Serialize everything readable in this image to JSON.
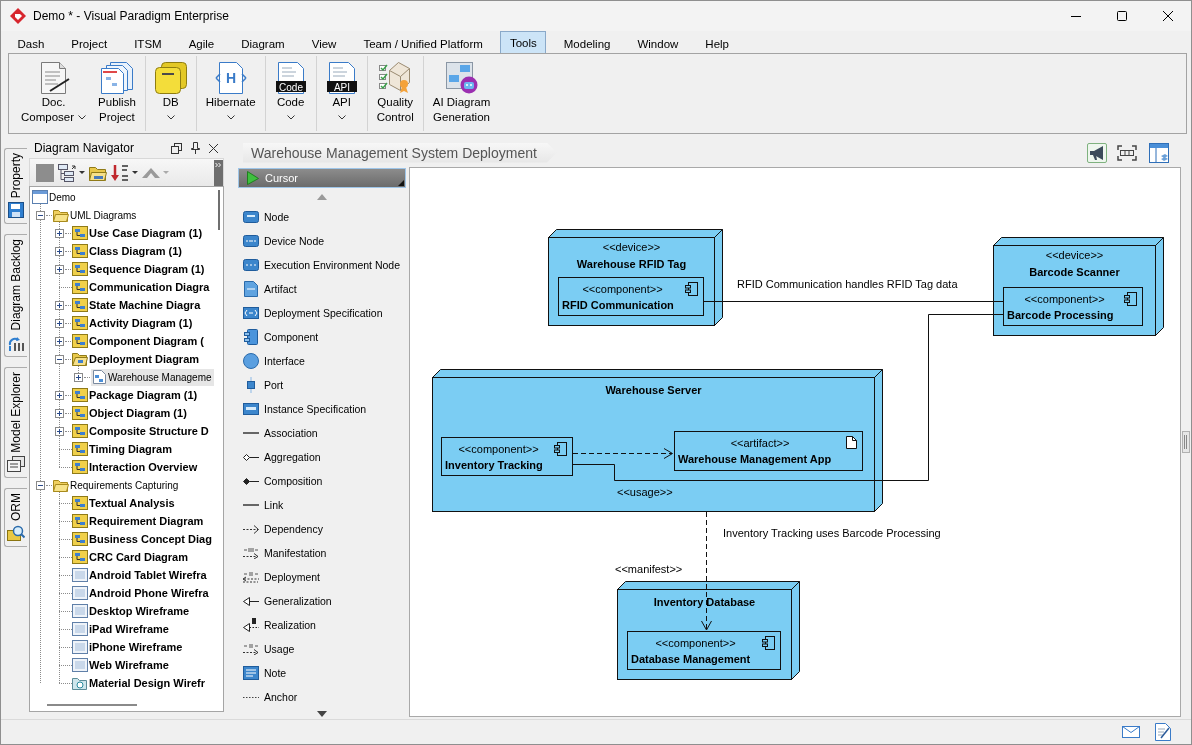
{
  "window": {
    "title": "Demo * - Visual Paradigm Enterprise"
  },
  "menu_tabs": [
    {
      "label": "Dash",
      "selected": false
    },
    {
      "label": "Project",
      "selected": false
    },
    {
      "label": "ITSM",
      "selected": false
    },
    {
      "label": "Agile",
      "selected": false
    },
    {
      "label": "Diagram",
      "selected": false
    },
    {
      "label": "View",
      "selected": false
    },
    {
      "label": "Team / Unified Platform",
      "selected": false
    },
    {
      "label": "Tools",
      "selected": true
    },
    {
      "label": "Modeling",
      "selected": false
    },
    {
      "label": "Window",
      "selected": false
    },
    {
      "label": "Help",
      "selected": false
    }
  ],
  "ribbon": {
    "groups": [
      [
        {
          "kind": "document",
          "lines": [
            "Doc.",
            "Composer"
          ],
          "dropdown": true
        },
        {
          "kind": "publish",
          "lines": [
            "Publish",
            "Project"
          ],
          "dropdown": false
        }
      ],
      [
        {
          "kind": "database",
          "lines": [
            "DB"
          ],
          "dropdown": true
        }
      ],
      [
        {
          "kind": "hibernate",
          "icon_text": "H",
          "lines": [
            "Hibernate"
          ],
          "dropdown": true
        }
      ],
      [
        {
          "kind": "code",
          "icon_text": "Code",
          "lines": [
            "Code"
          ],
          "dropdown": true
        }
      ],
      [
        {
          "kind": "api",
          "icon_text": "API",
          "lines": [
            "API"
          ],
          "dropdown": true
        }
      ],
      [
        {
          "kind": "quality",
          "lines": [
            "Quality",
            "Control"
          ],
          "dropdown": false
        }
      ],
      [
        {
          "kind": "ai-diagram",
          "lines": [
            "AI Diagram",
            "Generation"
          ],
          "dropdown": false
        }
      ]
    ]
  },
  "side_tabs": [
    {
      "label": "Property",
      "kind": "property",
      "selected": false
    },
    {
      "label": "Diagram Backlog",
      "kind": "backlog",
      "selected": false
    },
    {
      "label": "Model Explorer",
      "kind": "explorer",
      "selected": false
    },
    {
      "label": "ORM",
      "kind": "orm",
      "selected": false
    }
  ],
  "navigator": {
    "title": "Diagram Navigator",
    "tree": [
      {
        "label": "Demo",
        "kind": "project",
        "selected": false,
        "children": [
          {
            "label": "UML Diagrams",
            "kind": "folder",
            "expanded": true,
            "selected": false,
            "children": [
              {
                "label": "Use Case Diagram (1)",
                "kind": "uml",
                "expanded": false,
                "selected": false
              },
              {
                "label": "Class Diagram (1)",
                "kind": "uml",
                "expanded": false,
                "selected": false
              },
              {
                "label": "Sequence Diagram (1)",
                "kind": "uml",
                "expanded": false,
                "selected": false
              },
              {
                "label": "Communication Diagra",
                "kind": "uml",
                "selected": false
              },
              {
                "label": "State Machine Diagra",
                "kind": "uml",
                "expanded": false,
                "selected": false
              },
              {
                "label": "Activity Diagram (1)",
                "kind": "uml",
                "expanded": false,
                "selected": false
              },
              {
                "label": "Component Diagram (",
                "kind": "uml",
                "expanded": false,
                "selected": false
              },
              {
                "label": "Deployment Diagram",
                "kind": "uml-open",
                "expanded": true,
                "selected": false,
                "children": [
                  {
                    "label": "Warehouse Manageme",
                    "kind": "diagram",
                    "expanded": false,
                    "selected": true
                  }
                ]
              },
              {
                "label": "Package Diagram (1)",
                "kind": "uml",
                "expanded": false,
                "selected": false
              },
              {
                "label": "Object Diagram (1)",
                "kind": "uml",
                "expanded": false,
                "selected": false
              },
              {
                "label": "Composite Structure D",
                "kind": "uml",
                "expanded": false,
                "selected": false
              },
              {
                "label": "Timing Diagram",
                "kind": "uml",
                "selected": false
              },
              {
                "label": "Interaction Overview",
                "kind": "uml",
                "selected": false
              }
            ]
          },
          {
            "label": "Requirements Capturing",
            "kind": "folder",
            "expanded": true,
            "selected": false,
            "children": [
              {
                "label": "Textual Analysis",
                "kind": "uml",
                "selected": false
              },
              {
                "label": "Requirement Diagram",
                "kind": "uml",
                "selected": false
              },
              {
                "label": "Business Concept Diag",
                "kind": "uml",
                "selected": false
              },
              {
                "label": "CRC Card Diagram",
                "kind": "uml",
                "selected": false
              },
              {
                "label": "Android Tablet Wirefra",
                "kind": "wireframe",
                "selected": false
              },
              {
                "label": "Android Phone Wirefra",
                "kind": "wireframe",
                "selected": false
              },
              {
                "label": "Desktop Wireframe",
                "kind": "wireframe",
                "selected": false
              },
              {
                "label": "iPad Wireframe",
                "kind": "wireframe",
                "selected": false
              },
              {
                "label": "iPhone Wireframe",
                "kind": "wireframe",
                "selected": false
              },
              {
                "label": "Web Wireframe",
                "kind": "wireframe",
                "selected": false
              },
              {
                "label": "Material Design Wirefr",
                "kind": "material",
                "selected": false
              }
            ]
          }
        ]
      }
    ]
  },
  "editor": {
    "breadcrumb": "Warehouse Management System Deployment",
    "palette": {
      "cursor": {
        "label": "Cursor",
        "selected": true
      },
      "tools": [
        {
          "label": "Node",
          "kind": "node",
          "selected": false
        },
        {
          "label": "Device Node",
          "kind": "device-node",
          "selected": false
        },
        {
          "label": "Execution Environment Node",
          "kind": "exec-node",
          "selected": false
        },
        {
          "label": "Artifact",
          "kind": "artifact",
          "selected": false
        },
        {
          "label": "Deployment Specification",
          "kind": "deploy-spec",
          "selected": false
        },
        {
          "label": "Component",
          "kind": "component",
          "selected": false
        },
        {
          "label": "Interface",
          "kind": "interface",
          "selected": false
        },
        {
          "label": "Port",
          "kind": "port",
          "selected": false
        },
        {
          "label": "Instance Specification",
          "kind": "instance-spec",
          "selected": false
        },
        {
          "label": "Association",
          "kind": "association",
          "selected": false
        },
        {
          "label": "Aggregation",
          "kind": "aggregation",
          "selected": false
        },
        {
          "label": "Composition",
          "kind": "composition",
          "selected": false
        },
        {
          "label": "Link",
          "kind": "link",
          "selected": false
        },
        {
          "label": "Dependency",
          "kind": "dependency",
          "selected": false
        },
        {
          "label": "Manifestation",
          "kind": "manifestation",
          "selected": false
        },
        {
          "label": "Deployment",
          "kind": "deployment",
          "selected": false
        },
        {
          "label": "Generalization",
          "kind": "generalization",
          "selected": false
        },
        {
          "label": "Realization",
          "kind": "realization",
          "selected": false
        },
        {
          "label": "Usage",
          "kind": "usage",
          "selected": false
        },
        {
          "label": "Note",
          "kind": "note",
          "selected": false
        },
        {
          "label": "Anchor",
          "kind": "anchor",
          "selected": false
        }
      ]
    },
    "diagram": {
      "nodes": [
        {
          "stereotype": "<<device>>",
          "name": "Warehouse RFID Tag",
          "parts": [
            {
              "kind": "component",
              "stereotype": "<<component>>",
              "name": "RFID Communication"
            }
          ]
        },
        {
          "stereotype": "<<device>>",
          "name": "Barcode Scanner",
          "parts": [
            {
              "kind": "component",
              "stereotype": "<<component>>",
              "name": "Barcode Processing"
            }
          ]
        },
        {
          "name": "Warehouse Server",
          "parts": [
            {
              "kind": "component",
              "stereotype": "<<component>>",
              "name": "Inventory Tracking"
            },
            {
              "kind": "artifact",
              "stereotype": "<<artifact>>",
              "name": "Warehouse Management App"
            }
          ]
        },
        {
          "name": "Inventory Database",
          "parts": [
            {
              "kind": "component",
              "stereotype": "<<component>>",
              "name": "Database Management"
            }
          ]
        }
      ],
      "connectors": [
        {
          "kind": "line",
          "labels": [
            "RFID Communication handles RFID Tag data"
          ]
        },
        {
          "kind": "dashed-arrow"
        },
        {
          "kind": "line",
          "labels": [
            "<<usage>>",
            "Inventory Tracking uses Barcode Processing"
          ]
        },
        {
          "kind": "dashed-arrow",
          "labels": [
            "<<manifest>>"
          ]
        }
      ]
    }
  }
}
